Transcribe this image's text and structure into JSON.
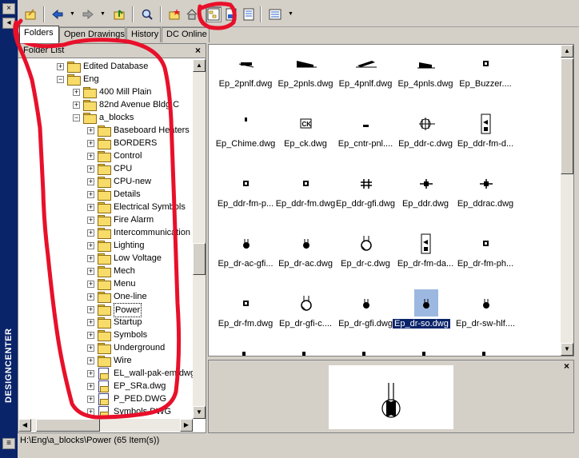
{
  "window": {
    "title": "DESIGNCENTER"
  },
  "toolbar": {
    "icons": [
      "load-icon",
      "back-icon",
      "forward-icon",
      "up-icon",
      "search-icon",
      "favorites-icon",
      "home-icon",
      "tree-toggle-icon",
      "preview-icon",
      "description-icon",
      "views-icon"
    ]
  },
  "tabs": [
    "Folders",
    "Open Drawings",
    "History",
    "DC Online"
  ],
  "folder_list": {
    "title": "Folder List",
    "close": "×",
    "items": [
      {
        "label": "Edited Database",
        "level": 2,
        "icon": "folder",
        "expand": "+"
      },
      {
        "label": "Eng",
        "level": 2,
        "icon": "folder",
        "expand": "−"
      },
      {
        "label": "400 Mill Plain",
        "level": 3,
        "icon": "folder",
        "expand": "+"
      },
      {
        "label": "82nd Avenue Bldg C",
        "level": 3,
        "icon": "folder",
        "expand": "+"
      },
      {
        "label": "a_blocks",
        "level": 3,
        "icon": "folder",
        "expand": "−"
      },
      {
        "label": "Baseboard Heaters",
        "level": 4,
        "icon": "folder",
        "expand": "+"
      },
      {
        "label": "BORDERS",
        "level": 4,
        "icon": "folder",
        "expand": "+"
      },
      {
        "label": "Control",
        "level": 4,
        "icon": "folder",
        "expand": "+"
      },
      {
        "label": "CPU",
        "level": 4,
        "icon": "folder",
        "expand": "+"
      },
      {
        "label": "CPU-new",
        "level": 4,
        "icon": "folder",
        "expand": "+"
      },
      {
        "label": "Details",
        "level": 4,
        "icon": "folder",
        "expand": "+"
      },
      {
        "label": "Electrical Symbols",
        "level": 4,
        "icon": "folder",
        "expand": "+"
      },
      {
        "label": "Fire Alarm",
        "level": 4,
        "icon": "folder",
        "expand": "+"
      },
      {
        "label": "Intercommunication",
        "level": 4,
        "icon": "folder",
        "expand": "+"
      },
      {
        "label": "Lighting",
        "level": 4,
        "icon": "folder",
        "expand": "+"
      },
      {
        "label": "Low Voltage",
        "level": 4,
        "icon": "folder",
        "expand": "+"
      },
      {
        "label": "Mech",
        "level": 4,
        "icon": "folder",
        "expand": "+"
      },
      {
        "label": "Menu",
        "level": 4,
        "icon": "folder",
        "expand": "+"
      },
      {
        "label": "One-line",
        "level": 4,
        "icon": "folder",
        "expand": "+"
      },
      {
        "label": "Power",
        "level": 4,
        "icon": "folder",
        "expand": "+",
        "selected": true
      },
      {
        "label": "Startup",
        "level": 4,
        "icon": "folder",
        "expand": "+"
      },
      {
        "label": "Symbols",
        "level": 4,
        "icon": "folder",
        "expand": "+"
      },
      {
        "label": "Underground",
        "level": 4,
        "icon": "folder",
        "expand": "+"
      },
      {
        "label": "Wire",
        "level": 4,
        "icon": "folder",
        "expand": "+"
      },
      {
        "label": "EL_wall-pak-em.dwg",
        "level": 4,
        "icon": "dwg",
        "expand": "+"
      },
      {
        "label": "EP_SRa.dwg",
        "level": 4,
        "icon": "dwg",
        "expand": "+"
      },
      {
        "label": "P_PED.DWG",
        "level": 4,
        "icon": "dwg",
        "expand": "+"
      },
      {
        "label": "Symbols.DWG",
        "level": 4,
        "icon": "dwg",
        "expand": "+"
      }
    ]
  },
  "files": [
    {
      "name": "Ep_2pnlf.dwg",
      "glyph": "pnl"
    },
    {
      "name": "Ep_2pnls.dwg",
      "glyph": "pnl2"
    },
    {
      "name": "Ep_4pnlf.dwg",
      "glyph": "pnl3"
    },
    {
      "name": "Ep_4pnls.dwg",
      "glyph": "pnl4"
    },
    {
      "name": "Ep_Buzzer....",
      "glyph": "sq"
    },
    {
      "name": "Ep_Chime.dwg",
      "glyph": "dot"
    },
    {
      "name": "Ep_ck.dwg",
      "glyph": "ck"
    },
    {
      "name": "Ep_cntr-pnl....",
      "glyph": "dash"
    },
    {
      "name": "Ep_ddr-c.dwg",
      "glyph": "cross"
    },
    {
      "name": "Ep_ddr-fm-d...",
      "glyph": "box"
    },
    {
      "name": "Ep_ddr-fm-p...",
      "glyph": "sq"
    },
    {
      "name": "Ep_ddr-fm.dwg",
      "glyph": "sq"
    },
    {
      "name": "Ep_ddr-gfi.dwg",
      "glyph": "hash"
    },
    {
      "name": "Ep_ddr.dwg",
      "glyph": "plus"
    },
    {
      "name": "Ep_ddrac.dwg",
      "glyph": "plus"
    },
    {
      "name": "Ep_dr-ac-gfi...",
      "glyph": "rec"
    },
    {
      "name": "Ep_dr-ac.dwg",
      "glyph": "rec"
    },
    {
      "name": "Ep_dr-c.dwg",
      "glyph": "circ"
    },
    {
      "name": "Ep_dr-fm-da...",
      "glyph": "box"
    },
    {
      "name": "Ep_dr-fm-ph...",
      "glyph": "sq"
    },
    {
      "name": "Ep_dr-fm.dwg",
      "glyph": "sq"
    },
    {
      "name": "Ep_dr-gfi-c....",
      "glyph": "circ"
    },
    {
      "name": "Ep_dr-gfi.dwg",
      "glyph": "rec"
    },
    {
      "name": "Ep_dr-so.dwg",
      "glyph": "rec",
      "selected": true
    },
    {
      "name": "Ep_dr-sw-hlf....",
      "glyph": "rec"
    }
  ],
  "preview": {
    "close": "×"
  },
  "status": {
    "text": "H:\\Eng\\a_blocks\\Power (65 Item(s))"
  }
}
